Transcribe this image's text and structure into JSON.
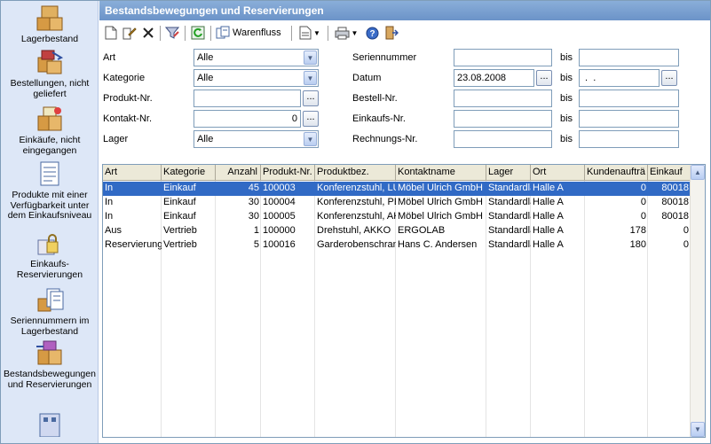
{
  "title": "Bestandsbewegungen und Reservierungen",
  "sidebar": {
    "items": [
      {
        "label": "Lagerbestand",
        "icon": "boxes-icon"
      },
      {
        "label": "Bestellungen, nicht geliefert",
        "icon": "order-boxes-icon"
      },
      {
        "label": "Einkäufe, nicht eingegangen",
        "icon": "purchase-boxes-icon"
      },
      {
        "label": "Produkte mit einer Verfügbarkeit unter dem Einkaufsniveau",
        "icon": "document-list-icon"
      },
      {
        "label": "Einkaufs-Reservierungen",
        "icon": "reservation-lock-icon"
      },
      {
        "label": "Seriennummern im Lagerbestand",
        "icon": "serial-docs-icon"
      },
      {
        "label": "Bestandsbewegungen und Reservierungen",
        "icon": "movement-boxes-icon"
      }
    ]
  },
  "toolbar": {
    "warenfluss_label": "Warenfluss"
  },
  "filters": {
    "art_label": "Art",
    "art_value": "Alle",
    "kategorie_label": "Kategorie",
    "kategorie_value": "Alle",
    "produkt_label": "Produkt-Nr.",
    "produkt_value": "",
    "kontakt_label": "Kontakt-Nr.",
    "kontakt_value": "0",
    "lager_label": "Lager",
    "lager_value": "Alle",
    "serien_label": "Seriennummer",
    "datum_label": "Datum",
    "datum_from": "23.08.2008",
    "datum_to": " .  .",
    "bestell_label": "Bestell-Nr.",
    "einkaufs_label": "Einkaufs-Nr.",
    "rechnungs_label": "Rechnungs-Nr.",
    "bis": "bis",
    "dots": "..."
  },
  "table": {
    "headers": [
      "Art",
      "Kategorie",
      "Anzahl",
      "Produkt-Nr.",
      "Produktbez.",
      "Kontaktname",
      "Lager",
      "Ort",
      "Kundenaufträ",
      "Einkauf"
    ],
    "rows": [
      [
        "In",
        "Einkauf",
        "45",
        "100003",
        "Konferenzstuhl, LU",
        "Möbel Ulrich GmbH",
        "Standardla",
        "Halle A",
        "0",
        "80018"
      ],
      [
        "In",
        "Einkauf",
        "30",
        "100004",
        "Konferenzstuhl, PE",
        "Möbel Ulrich GmbH",
        "Standardla",
        "Halle A",
        "0",
        "80018"
      ],
      [
        "In",
        "Einkauf",
        "30",
        "100005",
        "Konferenzstuhl, AK",
        "Möbel Ulrich GmbH",
        "Standardla",
        "Halle A",
        "0",
        "80018"
      ],
      [
        "Aus",
        "Vertrieb",
        "1",
        "100000",
        "Drehstuhl, AKKO",
        "ERGOLAB",
        "Standardla",
        "Halle A",
        "178",
        "0"
      ],
      [
        "Reservierung",
        "Vertrieb",
        "5",
        "100016",
        "Garderobenschran",
        "Hans C. Andersen",
        "Standardla",
        "Halle A",
        "180",
        "0"
      ]
    ],
    "selected_row": 0
  },
  "colors": {
    "titlebar": "#7aa0d0",
    "sidebar": "#dde7f7",
    "selection": "#316ac5"
  }
}
